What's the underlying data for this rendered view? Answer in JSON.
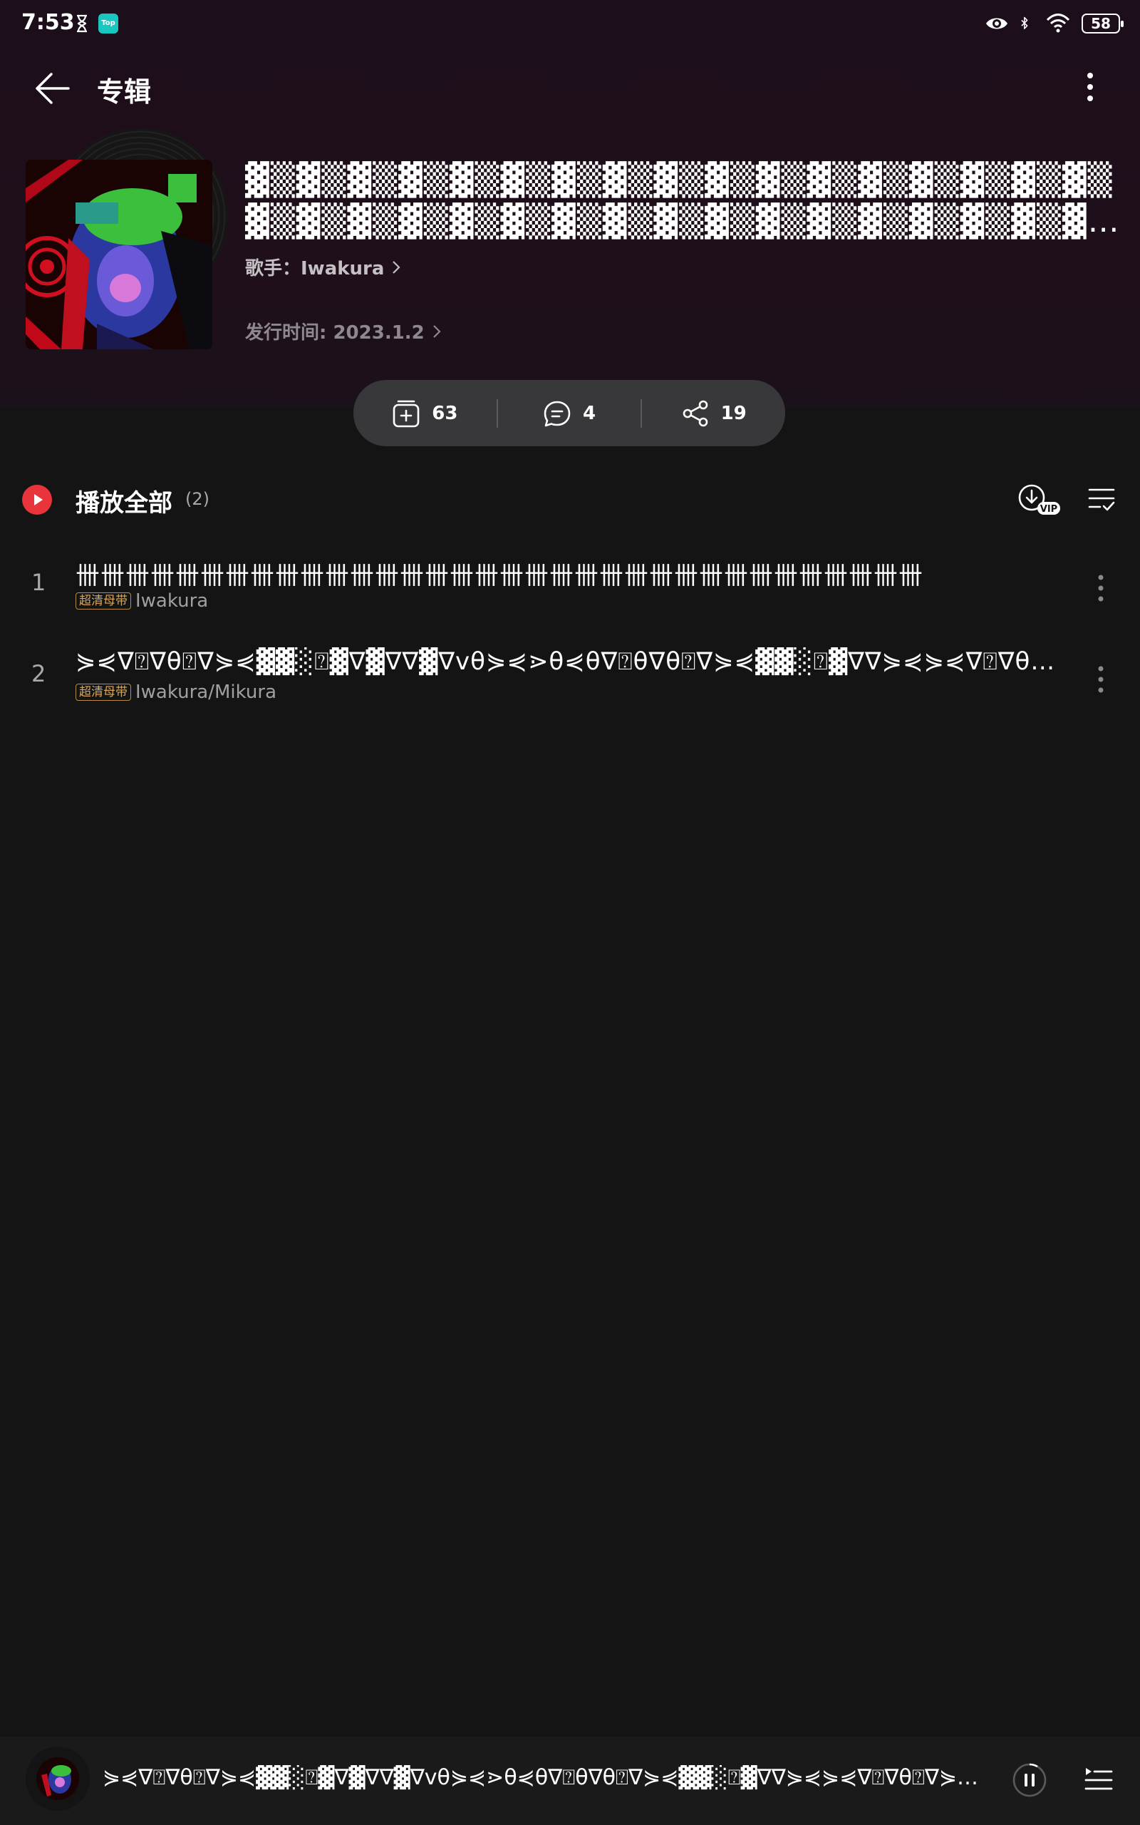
{
  "status_bar": {
    "time": "7:53",
    "top_app_label": "Top",
    "battery": "58"
  },
  "nav": {
    "title": "专辑"
  },
  "album": {
    "title": "▓▒▓▒▓▒▓▒▓▒▓▒▓▒▓▒▓▒▓▒▓▒▓▒▓▒▓▒▓▒▓▒▓▒▓▒▓▒▓▒▓▒▓▒▓▒▓▒▓▒▓▒▓▒▓▒▓▒▓▒▓▒▓▒▓▒▓▒▓▒▓▒▓▒▓▒▓▒▓▒▓▒▓▒▓▒▓▒▓▒▓▒",
    "artist": "歌手：Iwakura",
    "release_date": "发行时间: 2023.1.2"
  },
  "stats": {
    "collect": "63",
    "comments": "4",
    "share": "19"
  },
  "play_all": {
    "label": "播放全部",
    "count": "(2)",
    "download_badge": "VIP"
  },
  "tracks": [
    {
      "num": "1",
      "title": "卌卌卌卌卌卌卌卌卌卌卌卌卌卌卌卌卌卌卌卌卌卌卌卌卌卌卌卌卌卌卌卌卌卌",
      "badge": "超清母带",
      "artist": "Iwakura"
    },
    {
      "num": "2",
      "title": "⋟⋞∇⍰∇θ⍰∇⋟⋞▓▓░⍰▓∇▓∇∇▓∇vθ⋟⋞⋗θ⋞θ∇⍰θ∇θ⍰∇⋟⋞▓▓░⍰▓∇∇⋟⋞⋟⋞∇⍰∇θ⍰∇⋟⋞▓▓░⍰▓∇∇⋟⋞",
      "badge": "超清母带",
      "artist": "Iwakura/Mikura"
    }
  ],
  "mini_player": {
    "title": "⋟⋞∇⍰∇θ⍰∇⋟⋞▓▓░⍰▓∇▓∇∇▓∇vθ⋟⋞⋗θ⋞θ∇⍰θ∇θ⍰∇⋟⋞▓▓░⍰▓∇∇⋟⋞⋟⋞∇⍰∇θ⍰∇⋟⋞▓▓░⍰▓∇∇⋟⋞"
  },
  "colors": {
    "accent_red": "#e8343a",
    "header_bg": "#1d0f1b",
    "body_bg": "#141414",
    "badge_gold": "#d9a75a"
  }
}
